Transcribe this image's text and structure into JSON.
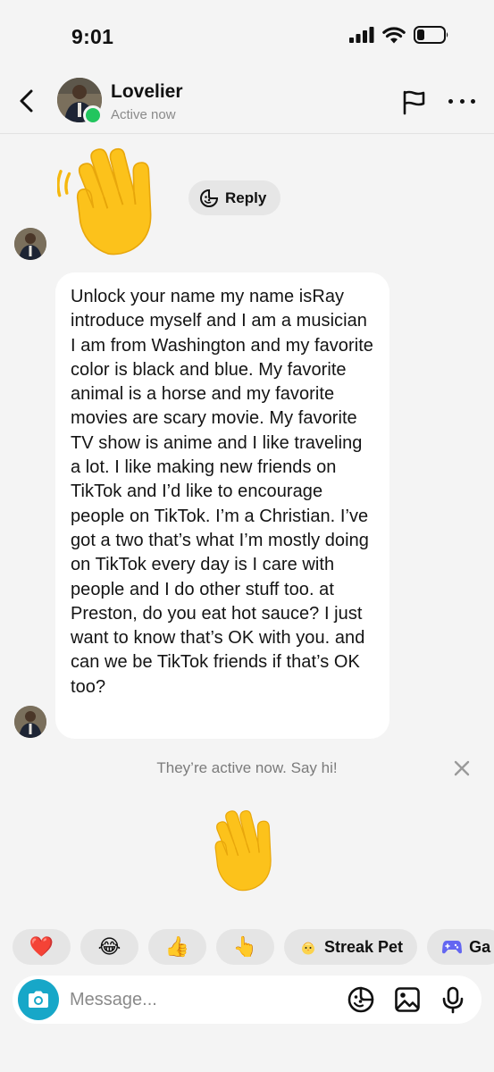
{
  "status_bar": {
    "time": "9:01"
  },
  "header": {
    "contact_name": "Lovelier",
    "contact_status": "Active now"
  },
  "thread": {
    "reply_label": "Reply",
    "message_text": "Unlock your name my name isRay introduce myself and I am a musician I am from Washington and my favorite color is black and blue. My favorite animal is a horse and my favorite movies are scary movie. My favorite TV show is anime and I like traveling a lot. I like making new friends on TikTok and I’d like to encourage people on TikTok. I’m a Christian. I’ve got a two that’s what I’m mostly doing on TikTok every day is I care with people and I do other stuff too. at Preston, do you eat hot sauce? I just want to know that’s OK with you. and can we be TikTok friends if that’s OK too?",
    "active_hint": "They’re active now. Say hi!"
  },
  "quick_reactions": {
    "items": [
      {
        "emoji": "❤️"
      },
      {
        "emoji": "😂"
      },
      {
        "emoji": "👍"
      },
      {
        "emoji": "👆"
      }
    ],
    "streak_pet_label": "Streak Pet",
    "games_label": "Ga"
  },
  "composer": {
    "placeholder": "Message..."
  },
  "colors": {
    "background": "#f4f4f4",
    "online_dot": "#22c55e",
    "camera_button": "#17a7c8",
    "chip": "#e5e5e5",
    "bubble": "#ffffff"
  },
  "icons": {
    "status": [
      "signal-icon",
      "wifi-icon",
      "battery-icon"
    ],
    "header": [
      "back-arrow-icon",
      "flag-icon",
      "more-icon"
    ],
    "composer": [
      "camera-icon",
      "sticker-icon",
      "image-icon",
      "microphone-icon"
    ],
    "other": [
      "waving-hand-icon",
      "sticker-reply-icon",
      "close-icon",
      "game-controller-icon",
      "pet-chick-icon"
    ]
  }
}
